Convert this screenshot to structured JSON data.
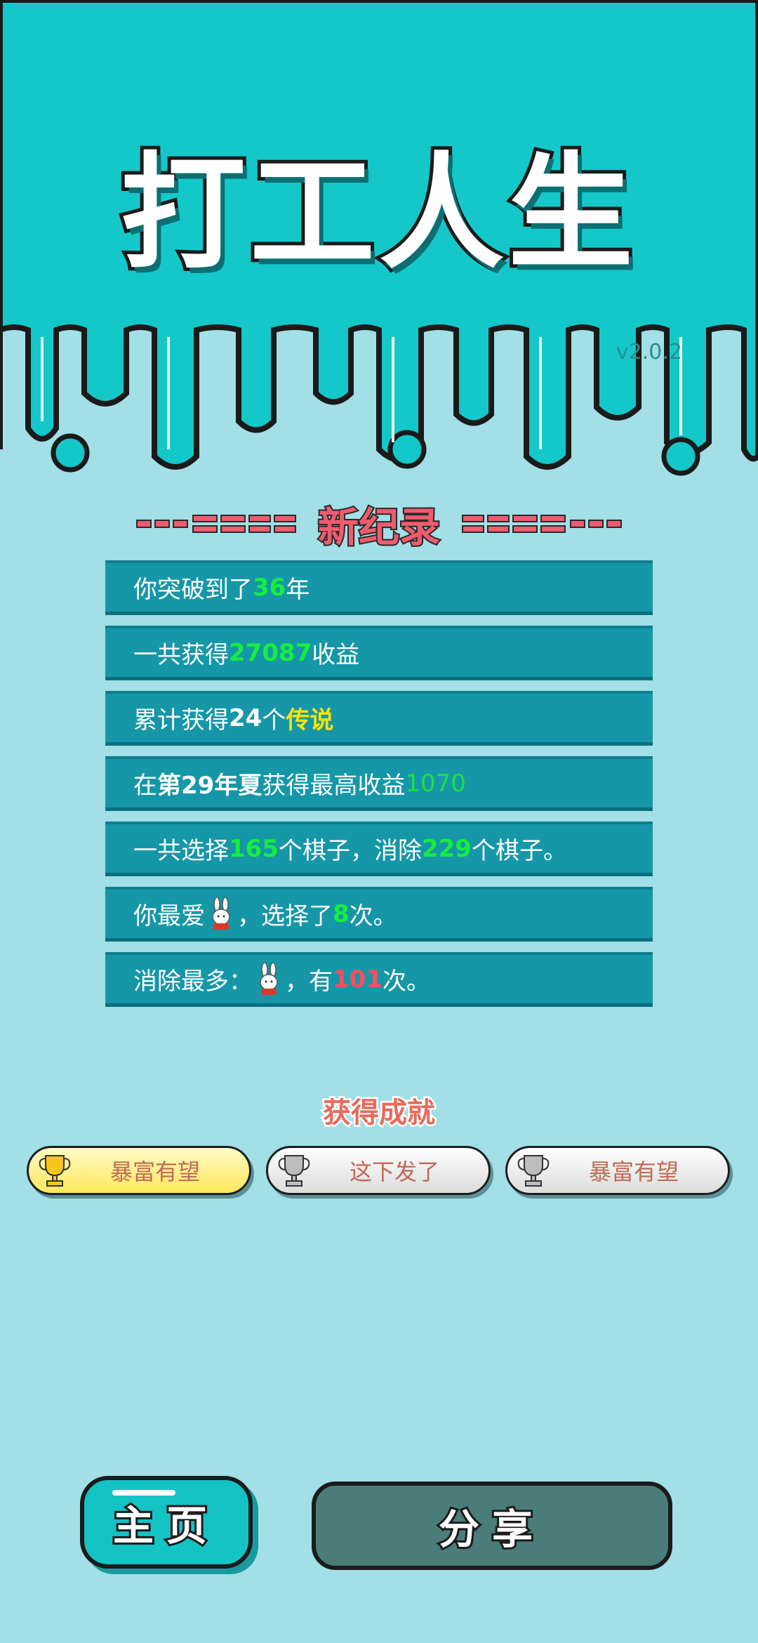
{
  "app": {
    "title": "打工人生",
    "version": "v2.0.2"
  },
  "record": {
    "heading": "新纪录",
    "rows": [
      {
        "a": "你突破到了",
        "b": "36",
        "c": "年"
      },
      {
        "a": "一共获得",
        "b": "27087",
        "c": "收益"
      },
      {
        "a": "累计获得",
        "b": "24",
        "c": "个",
        "d": "传说"
      },
      {
        "a": "在 ",
        "b": "第29年夏",
        "c": " 获得最高收益",
        "d": "1070"
      },
      {
        "a": "一共选择",
        "b": "165",
        "c": "个棋子，消除",
        "d": "229",
        "e": "个棋子。"
      },
      {
        "a": "你最爱",
        "c": "，选择了",
        "d": "8",
        "e": "次。",
        "icon": "bunny-icon"
      },
      {
        "a": "消除最多：",
        "c": "，有",
        "d": "101",
        "e": "次。",
        "icon": "bunny-icon"
      }
    ]
  },
  "achievements": {
    "title": "获得成就",
    "badges": [
      {
        "label": "暴富有望",
        "tier": "gold",
        "icon": "trophy-icon"
      },
      {
        "label": "这下发了",
        "tier": "silver",
        "icon": "trophy-icon"
      },
      {
        "label": "暴富有望",
        "tier": "silver",
        "icon": "trophy-icon"
      }
    ]
  },
  "buttons": {
    "home": "主页",
    "share": "分享"
  },
  "colors": {
    "top_bg": "#14c8c9",
    "page_bg": "#a2dfe6",
    "row_bg": "#1597a8",
    "highlight_green": "#16ee3c",
    "highlight_yellow": "#ffe400",
    "highlight_red": "#ff4d5e",
    "heading_red": "#f05b6e"
  }
}
